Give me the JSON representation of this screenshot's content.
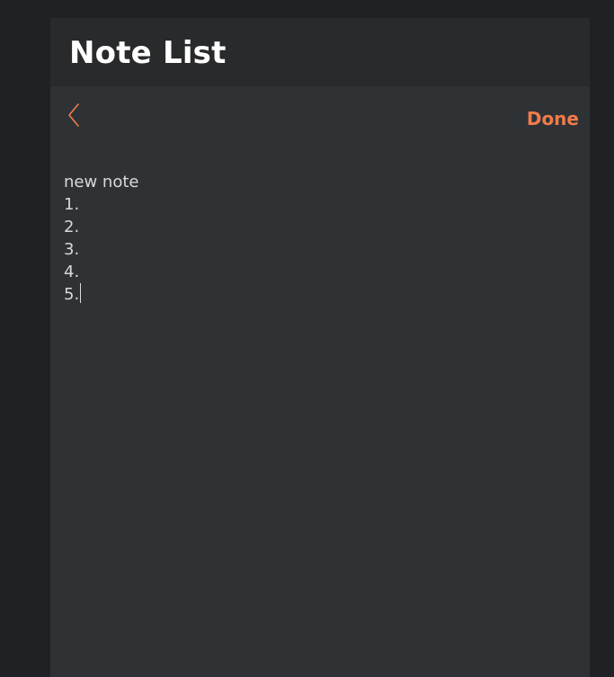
{
  "header": {
    "title": "Note List"
  },
  "toolbar": {
    "back_icon": "chevron-left-icon",
    "done_label": "Done"
  },
  "colors": {
    "accent": "#f07b4a",
    "background": "#1f2124",
    "panel": "#2e3235",
    "header": "#282a2c",
    "text": "#d9d9d9"
  },
  "note": {
    "title": "new note",
    "lines": [
      "1.",
      "2.",
      "3.",
      "4.",
      "5."
    ]
  }
}
